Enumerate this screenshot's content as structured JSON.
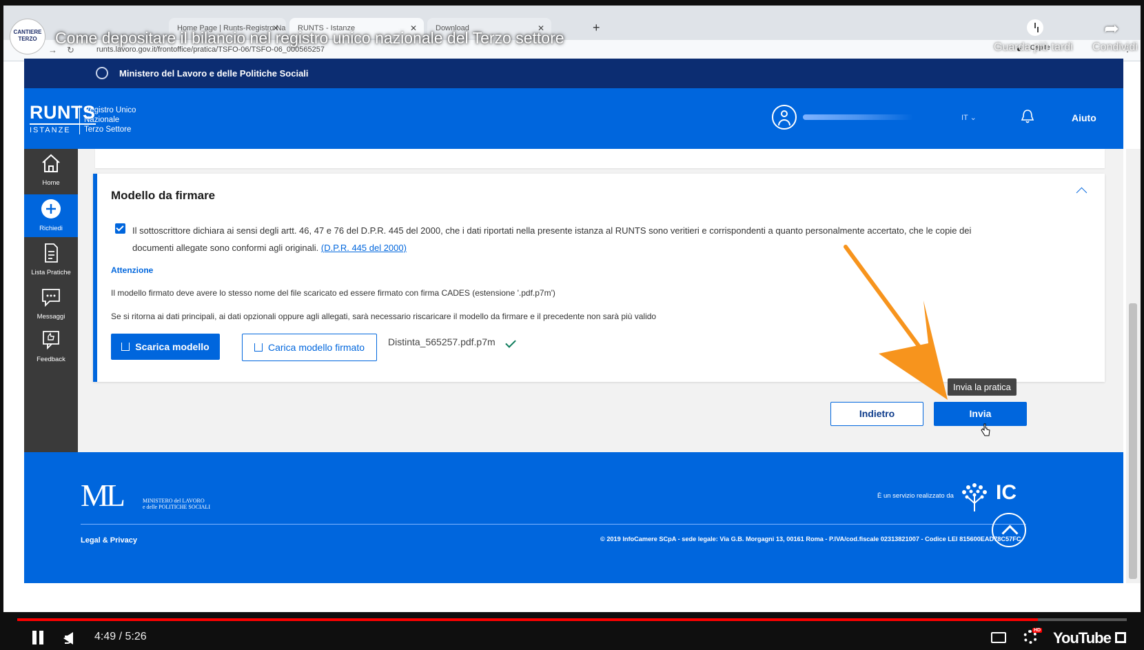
{
  "video": {
    "title": "Come depositare il bilancio nel registro unico nazionale del Terzo settore",
    "channel_logo_text": "CANTIERE TERZO",
    "watch_later": "Guarda più tardi",
    "share": "Condividi",
    "time": "4:49 / 5:26",
    "progress": 0.92,
    "brand": "YouTube",
    "hd": "HD"
  },
  "browser": {
    "tabs": [
      {
        "label": "Home Page | Runts-Registro Na"
      },
      {
        "label": "RUNTS - Istanze"
      },
      {
        "label": "Download"
      }
    ],
    "url": "runts.lavoro.gov.it/frontoffice/pratica/TSFO-06/TSFO-06_000565257",
    "profile": "Ospite"
  },
  "ministry_bar": {
    "label": "Ministero del Lavoro e delle Politiche Sociali"
  },
  "header": {
    "logo_big": "RUNTS",
    "logo_small": "ISTANZE",
    "subtitle_1": "Registro Unico",
    "subtitle_2": "Nazionale",
    "subtitle_3": "Terzo Settore",
    "lang": "IT",
    "help": "Aiuto"
  },
  "sidebar": {
    "items": [
      {
        "label": "Home"
      },
      {
        "label": "Richiedi"
      },
      {
        "label": "Lista Pratiche"
      },
      {
        "label": "Messaggi"
      },
      {
        "label": "Feedback"
      }
    ]
  },
  "card": {
    "title": "Modello da firmare",
    "declaration": "Il sottoscrittore dichiara ai sensi degli artt. 46, 47 e 76 del D.P.R. 445 del 2000, che i dati riportati nella presente istanza al RUNTS sono veritieri e corrispondenti a quanto personalmente accertato, che le copie dei documenti allegate sono conformi agli originali.",
    "declaration_link": "(D.P.R. 445 del 2000)",
    "attention": "Attenzione",
    "info_1": "Il modello firmato deve avere lo stesso nome del file scaricato ed essere firmato con firma CADES (estensione '.pdf.p7m')",
    "info_2": "Se si ritorna ai dati principali, ai dati opzionali oppure agli allegati, sarà necessario riscaricare il modello da firmare e il precedente non sarà più valido",
    "download_button": "Scarica modello",
    "upload_button": "Carica modello firmato",
    "uploaded_file": "Distinta_565257.pdf.p7m"
  },
  "actions": {
    "back": "Indietro",
    "send": "Invia",
    "send_tooltip": "Invia la pratica"
  },
  "footer": {
    "ministry_line_1": "MINISTERO del LAVORO",
    "ministry_line_2": "e delle POLITICHE SOCIALI",
    "service": "È un servizio realizzato da",
    "ic": "IC",
    "legal": "Legal & Privacy",
    "copyright": "© 2019 InfoCamere SCpA - sede legale: Via G.B. Morgagni 13, 00161 Roma - P.IVA/cod.fiscale 02313821007 - Codice LEI 815600EAD78C57FC"
  },
  "colors": {
    "primary": "#0066dd",
    "ministry": "#0c2d72",
    "sidebar": "#3a3a3a",
    "arrow": "#f7941d"
  }
}
